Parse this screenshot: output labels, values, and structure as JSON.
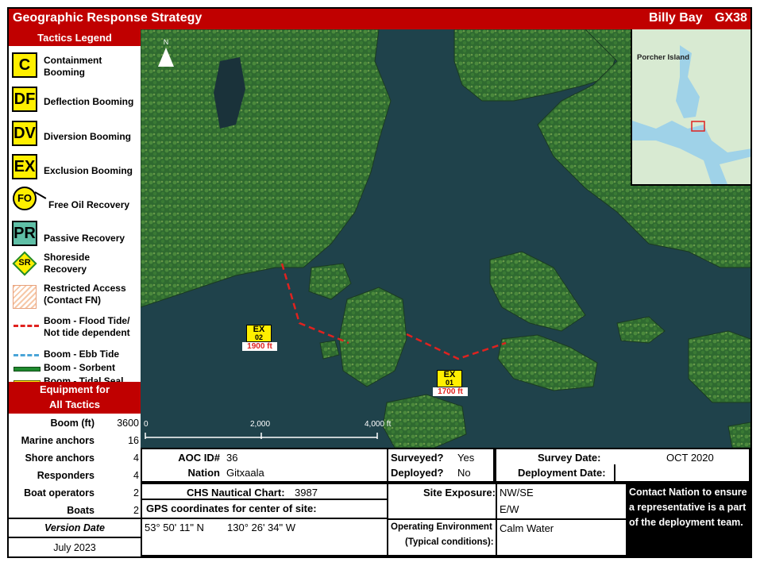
{
  "header": {
    "title": "Geographic Response Strategy",
    "location": "Billy Bay",
    "site_id": "GX38"
  },
  "legend": {
    "title": "Tactics Legend",
    "items": [
      {
        "code": "C",
        "label": "Containment Booming"
      },
      {
        "code": "DF",
        "label": "Deflection Booming"
      },
      {
        "code": "DV",
        "label": "Diversion Booming"
      },
      {
        "code": "EX",
        "label": "Exclusion Booming"
      },
      {
        "code": "FO",
        "label": "Free Oil Recovery"
      },
      {
        "code": "PR",
        "label": "Passive Recovery"
      },
      {
        "code": "SR",
        "label": "Shoreside Recovery"
      },
      {
        "code": "",
        "label": "Restricted Access (Contact FN)"
      },
      {
        "code": "",
        "label": "Boom - Flood Tide/ Not tide dependent"
      },
      {
        "code": "",
        "label": "Boom - Ebb Tide"
      },
      {
        "code": "",
        "label": "Boom - Sorbent"
      },
      {
        "code": "",
        "label": "Boom - Tidal Seal"
      }
    ],
    "colors": {
      "yellow": "#ffef00",
      "teal": "#5fbfa6",
      "flood": "#e0221f",
      "ebb": "#4aa5d8",
      "sorbent": "#1f8a2e",
      "tidal": "#ffef00"
    }
  },
  "equipment": {
    "title_line1": "Equipment for",
    "title_line2": "All Tactics",
    "rows": [
      {
        "k": "Boom (ft)",
        "v": "3600"
      },
      {
        "k": "Marine anchors",
        "v": "16"
      },
      {
        "k": "Shore anchors",
        "v": "4"
      },
      {
        "k": "Responders",
        "v": "4"
      },
      {
        "k": "Boat operators",
        "v": "2"
      },
      {
        "k": "Boats",
        "v": "2"
      }
    ]
  },
  "version": {
    "label": "Version Date",
    "value": "July 2023"
  },
  "map": {
    "north": "N",
    "markers": [
      {
        "code": "EX",
        "num": "02",
        "len": "1900 ft"
      },
      {
        "code": "EX",
        "num": "01",
        "len": "1700 ft"
      }
    ],
    "scale": {
      "t0": "0",
      "t1": "2,000",
      "t2": "4,000 ft"
    },
    "inset_label": "Porcher Island"
  },
  "info": {
    "aoc_label": "AOC ID#",
    "aoc_value": "36",
    "nation_label": "Nation",
    "nation_value": "Gitxaala",
    "chs_label": "CHS Nautical Chart:",
    "chs_value": "3987",
    "gps_label": "GPS coordinates for center of site:",
    "gps_lat": "53° 50' 11\"  N",
    "gps_lon": "130° 26' 34\"  W",
    "surveyed_label": "Surveyed?",
    "surveyed_value": "Yes",
    "deployed_label": "Deployed?",
    "deployed_value": "No",
    "survey_date_label": "Survey Date:",
    "survey_date_value": "OCT  2020",
    "deployment_date_label": "Deployment Date:",
    "deployment_date_value": "",
    "exposure_label": "Site Exposure:",
    "exposure_1": "NW/SE",
    "exposure_2": "E/W",
    "env_label1": "Operating Environment",
    "env_label2": "(Typical conditions):",
    "env_value": "Calm Water",
    "contact": "Contact Nation to ensure a representative is a part of the deployment team."
  }
}
